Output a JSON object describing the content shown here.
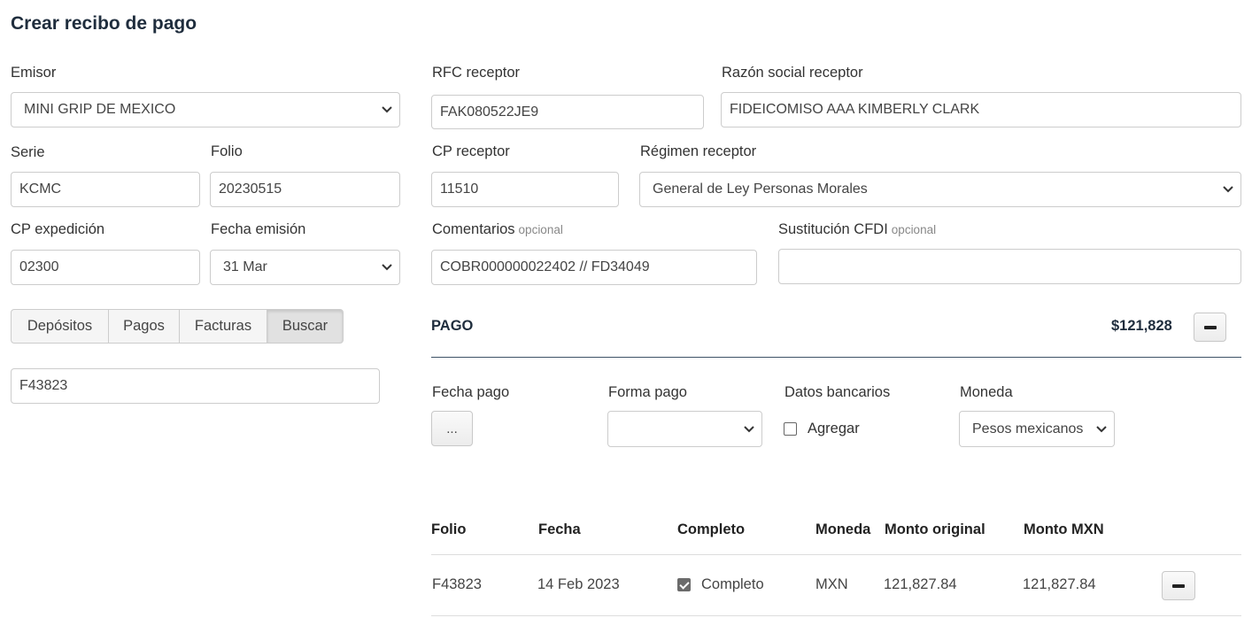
{
  "page": {
    "title": "Crear recibo de pago"
  },
  "emisor": {
    "label": "Emisor",
    "value": "MINI GRIP DE MEXICO"
  },
  "serie": {
    "label": "Serie",
    "value": "KCMC"
  },
  "folio": {
    "label": "Folio",
    "value": "20230515"
  },
  "cp_expedicion": {
    "label": "CP expedición",
    "value": "02300"
  },
  "fecha_emision": {
    "label": "Fecha emisión",
    "value": "31 Mar"
  },
  "rfc_receptor": {
    "label": "RFC receptor",
    "value": "FAK080522JE9"
  },
  "razon_social": {
    "label": "Razón social receptor",
    "value": "FIDEICOMISO AAA KIMBERLY CLARK"
  },
  "cp_receptor": {
    "label": "CP receptor",
    "value": "11510"
  },
  "regimen_receptor": {
    "label": "Régimen receptor",
    "value": "General de Ley Personas Morales"
  },
  "comentarios": {
    "label": "Comentarios",
    "optional": "opcional",
    "value": "COBR000000022402 // FD34049"
  },
  "sustitucion": {
    "label": "Sustitución CFDI",
    "optional": "opcional",
    "value": ""
  },
  "tabs": [
    {
      "label": "Depósitos"
    },
    {
      "label": "Pagos"
    },
    {
      "label": "Facturas"
    },
    {
      "label": "Buscar"
    }
  ],
  "search": {
    "value": "F43823"
  },
  "pago": {
    "title": "PAGO",
    "total": "$121,828",
    "fecha_pago": {
      "label": "Fecha pago",
      "button": "..."
    },
    "forma_pago": {
      "label": "Forma pago",
      "value": ""
    },
    "datos_bancarios": {
      "label": "Datos bancarios",
      "checkbox_label": "Agregar",
      "checked": false
    },
    "moneda": {
      "label": "Moneda",
      "value": "Pesos mexicanos"
    }
  },
  "table": {
    "headers": [
      "Folio",
      "Fecha",
      "Completo",
      "Moneda",
      "Monto original",
      "Monto MXN"
    ],
    "rows": [
      {
        "folio": "F43823",
        "fecha": "14 Feb 2023",
        "completo_label": "Completo",
        "completo_checked": true,
        "moneda": "MXN",
        "monto_original": "121,827.84",
        "monto_mxn": "121,827.84"
      }
    ]
  },
  "colors": {
    "divider": "#3d5166",
    "border": "#cccccc",
    "title": "#1f2d3d"
  },
  "icons": {
    "select_arrow": "chevron-down-icon",
    "remove": "minus-icon"
  }
}
